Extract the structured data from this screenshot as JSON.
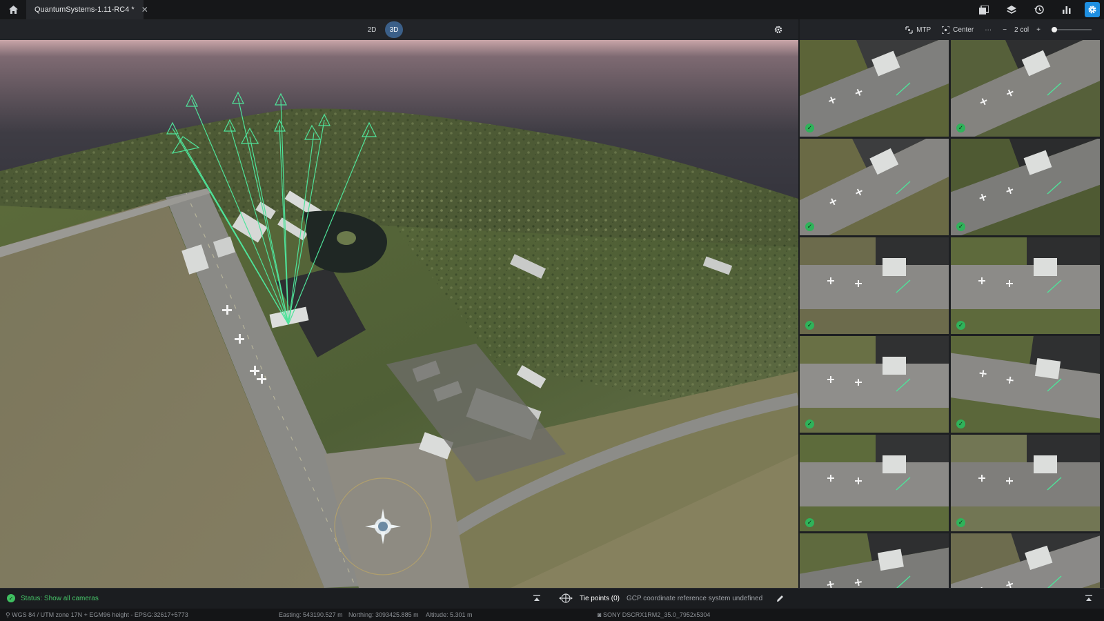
{
  "tab": {
    "title": "QuantumSystems-1.11-RC4 *"
  },
  "topbar_icons": [
    "gallery-icon",
    "layers-icon",
    "history-icon",
    "stats-icon",
    "settings-icon"
  ],
  "view": {
    "mode_2d": "2D",
    "mode_3d": "3D",
    "active_mode": "3D"
  },
  "right_panel": {
    "mtp_label": "MTP",
    "center_label": "Center",
    "more_label": "···",
    "columns_label": "2 col",
    "zoom_level": 0
  },
  "thumbnails": [
    {
      "verified": true
    },
    {
      "verified": true
    },
    {
      "verified": true
    },
    {
      "verified": true
    },
    {
      "verified": true
    },
    {
      "verified": true
    },
    {
      "verified": true
    },
    {
      "verified": true
    },
    {
      "verified": true
    },
    {
      "verified": true
    },
    {
      "verified": false
    },
    {
      "verified": false
    }
  ],
  "status": {
    "message": "Status: Show all cameras",
    "tie_points": "Tie points (0)",
    "gcp_note": "GCP coordinate reference system undefined"
  },
  "info": {
    "crs": "WGS 84 / UTM zone 17N + EGM96 height - EPSG:32617+5773",
    "easting": "Easting: 543190.527 m",
    "northing": "Northing: 3093425.885 m",
    "altitude": "Altitude: 5.301 m",
    "camera": "SONY DSCRX1RM2_35.0_7952x5304"
  },
  "colors": {
    "accent": "#1e8fe1",
    "status_green": "#46c468",
    "camera_frustum": "#4fe39a"
  }
}
